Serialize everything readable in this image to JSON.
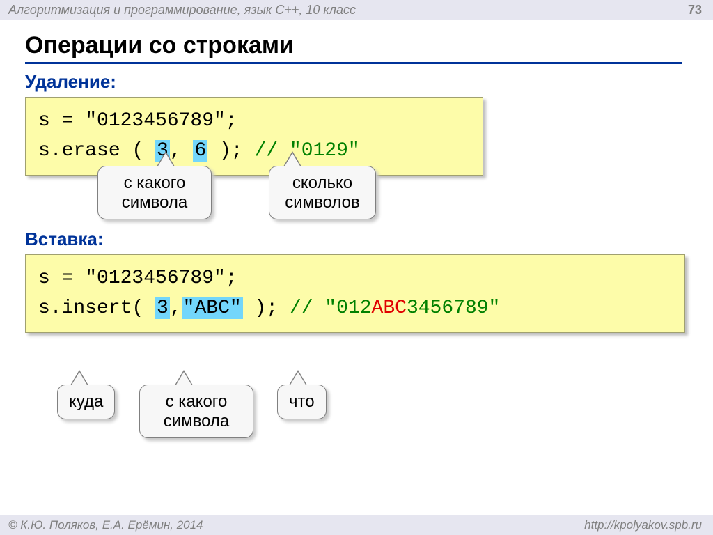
{
  "header": {
    "course": "Алгоритмизация и программирование, язык C++, 10 класс",
    "pagenum": "73"
  },
  "title": "Операции со строками",
  "section1": {
    "heading": "Удаление:",
    "code": {
      "line1_a": "s = \"0123456789\";",
      "line2_a": "s.erase ( ",
      "arg1": "3",
      "sep": ", ",
      "arg2": "6",
      "line2_b": " ); ",
      "comment": "// \"0129\""
    },
    "bubble_from": "с какого символа",
    "bubble_count": "сколько символов"
  },
  "section2": {
    "heading": "Вставка:",
    "code": {
      "line1_a": "s = \"0123456789\";",
      "line2_a": "s.insert( ",
      "arg1": "3",
      "sep": ",",
      "arg2": "\"ABC\"",
      "line2_b": " ); ",
      "comment_a": "// \"012",
      "comment_red": "ABC",
      "comment_b": "3456789\""
    },
    "bubble_where": "куда",
    "bubble_from2": "с какого символа",
    "bubble_what": "что"
  },
  "footer": {
    "left": "© К.Ю. Поляков, Е.А. Ерёмин, 2014",
    "right": "http://kpolyakov.spb.ru"
  }
}
